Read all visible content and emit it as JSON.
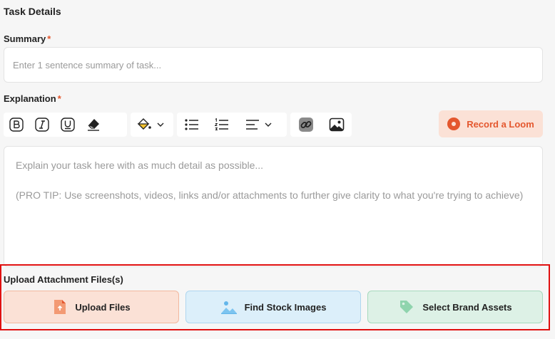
{
  "section_title": "Task Details",
  "summary": {
    "label": "Summary",
    "required_mark": "*",
    "placeholder": "Enter 1 sentence summary of task...",
    "value": ""
  },
  "explanation": {
    "label": "Explanation",
    "required_mark": "*",
    "placeholder_line1": "Explain your task here with as much detail as possible...",
    "placeholder_line2": "(PRO TIP: Use screenshots, videos, links and/or attachments to further give clarity to what you're trying to achieve)"
  },
  "toolbar": {
    "icons": [
      "bold-icon",
      "italic-icon",
      "underline-icon",
      "eraser-icon",
      "fill-color-icon",
      "bulleted-list-icon",
      "numbered-list-icon",
      "align-icon",
      "link-icon",
      "image-icon"
    ],
    "loom_label": "Record a Loom"
  },
  "attachments": {
    "title": "Upload Attachment Files(s)",
    "buttons": [
      {
        "label": "Upload Files",
        "icon": "upload-file-icon",
        "color": "#fbe1d6"
      },
      {
        "label": "Find Stock Images",
        "icon": "stock-image-icon",
        "color": "#dceffa"
      },
      {
        "label": "Select Brand Assets",
        "icon": "brand-tag-icon",
        "color": "#ddf1e6"
      }
    ]
  },
  "colors": {
    "accent": "#e4572e",
    "highlight_border": "#e01010"
  }
}
